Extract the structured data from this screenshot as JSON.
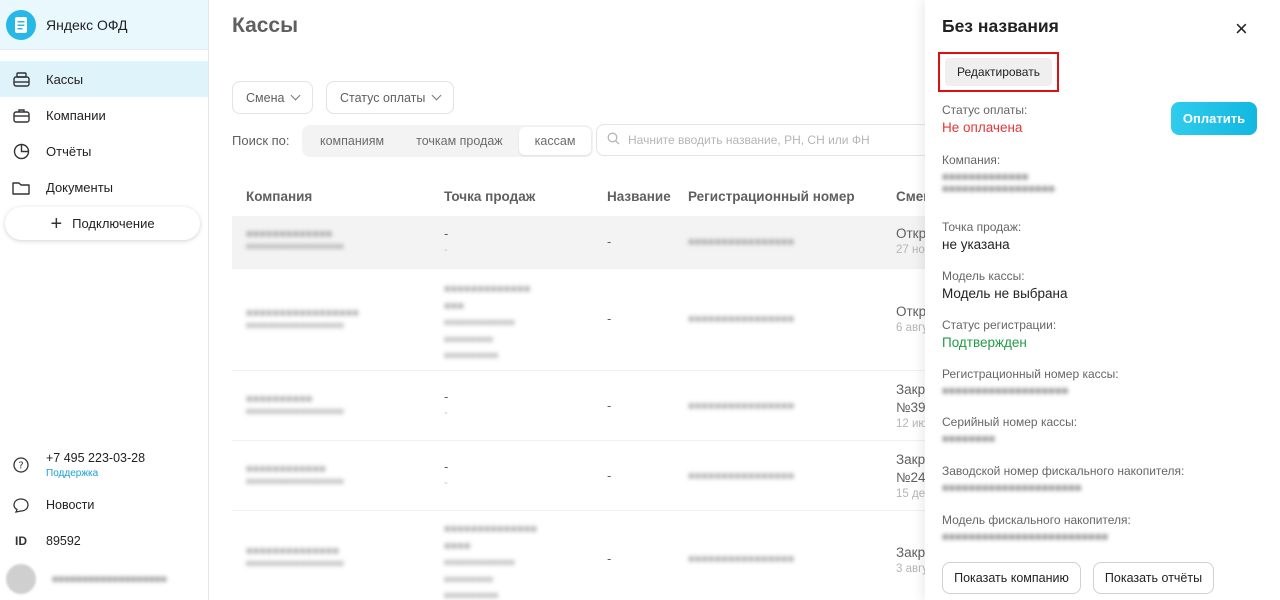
{
  "app": {
    "name": "Яндекс ОФД"
  },
  "sidebar": {
    "items": [
      {
        "label": "Кассы",
        "icon": "cashbox-icon"
      },
      {
        "label": "Компании",
        "icon": "briefcase-icon"
      },
      {
        "label": "Отчёты",
        "icon": "chart-icon"
      },
      {
        "label": "Документы",
        "icon": "folder-icon"
      }
    ],
    "connect_label": "Подключение",
    "phone": "+7 495 223-03-28",
    "support": "Поддержка",
    "news": "Новости",
    "id_label": "ID",
    "id_value": "89592"
  },
  "main": {
    "title": "Кассы",
    "filters": {
      "shift": "Смена",
      "payment_status": "Статус оплаты"
    },
    "search_by_label": "Поиск по:",
    "segments": [
      "компаниям",
      "точкам продаж",
      "кассам"
    ],
    "search_placeholder": "Начните вводить название, РН, СН или ФН",
    "columns": [
      "Компания",
      "Точка продаж",
      "Название",
      "Регистрационный номер",
      "Смена"
    ],
    "rows": [
      {
        "point": "-",
        "point_sub": "-",
        "name": "-",
        "smena": "Откр",
        "smena_sub": "27 но"
      },
      {
        "name": "-",
        "smena": "Откр",
        "smena_sub": "6 авгу"
      },
      {
        "point": "-",
        "point_sub": "-",
        "name": "-",
        "smena": "Закр",
        "smena_line2": "№39",
        "smena_sub": "12 ию"
      },
      {
        "point": "-",
        "point_sub": "-",
        "name": "-",
        "smena": "Закр",
        "smena_line2": "№24",
        "smena_sub": "15 де"
      },
      {
        "name": "-",
        "smena": "Закр",
        "smena_sub": "3 авгу"
      }
    ]
  },
  "panel": {
    "title": "Без названия",
    "edit_label": "Редактировать",
    "pay_label": "Оплатить",
    "fields": {
      "payment_status": {
        "label": "Статус оплаты:",
        "value": "Не оплачена"
      },
      "company": {
        "label": "Компания:"
      },
      "sale_point": {
        "label": "Точка продаж:",
        "value": "не указана"
      },
      "model": {
        "label": "Модель кассы:",
        "value": "Модель не выбрана"
      },
      "reg_status": {
        "label": "Статус регистрации:",
        "value": "Подтвержден"
      },
      "reg_number": {
        "label": "Регистрационный номер кассы:"
      },
      "serial": {
        "label": "Серийный номер кассы:"
      },
      "fn_number": {
        "label": "Заводской номер фискального накопителя:"
      },
      "fn_model": {
        "label": "Модель фискального накопителя:"
      }
    },
    "show_company_label": "Показать компанию",
    "show_reports_label": "Показать отчёты"
  },
  "colors": {
    "accent": "#27b8e8",
    "error": "#e43636",
    "success": "#1e9c45"
  }
}
